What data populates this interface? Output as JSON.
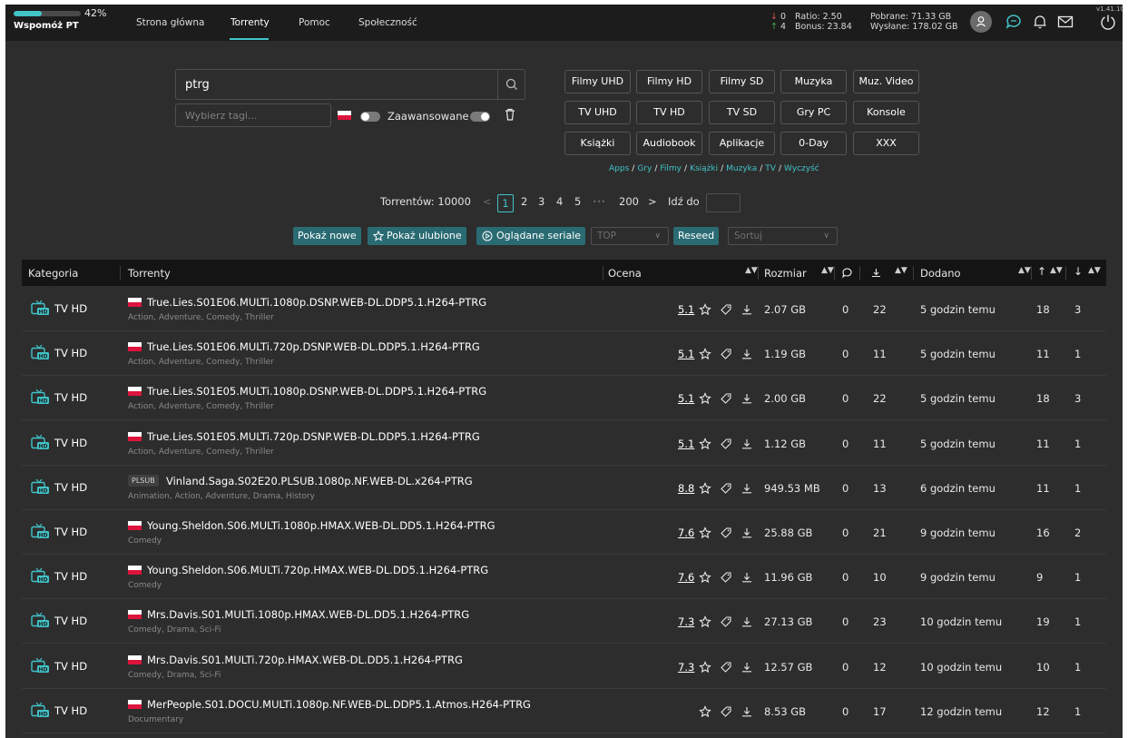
{
  "topbar": {
    "support_label": "Wspomóż PT",
    "support_pct_text": "42%",
    "support_progress": 0.42,
    "nav": [
      "Strona główna",
      "Torrenty",
      "Pomoc",
      "Społeczność"
    ],
    "active_nav_index": 1,
    "stats": {
      "down_arrow": "↓",
      "up_arrow": "↑",
      "down_count": "0",
      "up_count": "4",
      "ratio": "Ratio: 2.50",
      "bonus": "Bonus: 23.84",
      "downloaded": "Pobrane: 71.33 GB",
      "uploaded": "Wysłane: 178.02 GB"
    },
    "version": "v1.41.10",
    "accent_color": "#41c3c8"
  },
  "search": {
    "query": "ptrg",
    "tags_placeholder": "Wybierz tagi...",
    "advanced_label": "Zaawansowane"
  },
  "categories": [
    [
      "Filmy UHD",
      "Filmy HD",
      "Filmy SD",
      "Muzyka",
      "Muz. Video"
    ],
    [
      "TV UHD",
      "TV HD",
      "TV SD",
      "Gry PC",
      "Konsole"
    ],
    [
      "Książki",
      "Audiobook",
      "Aplikacje",
      "0-Day",
      "XXX"
    ]
  ],
  "crumbs": [
    "Apps",
    "Gry",
    "Filmy",
    "Książki",
    "Muzyka",
    "TV",
    "Wyczyść"
  ],
  "crumb_sep": "/",
  "pagination": {
    "total_label": "Torrentów: 10000",
    "prev": "<",
    "pages": [
      "1",
      "2",
      "3",
      "4",
      "5"
    ],
    "ellipsis": "•••",
    "last": "200",
    "next": ">",
    "goto_label": "Idź do"
  },
  "actions": {
    "show_new": "Pokaż nowe",
    "show_favorites": "Pokaż ulubione",
    "watched_series": "Oglądane seriale",
    "top_placeholder": "TOP",
    "reseed": "Reseed",
    "sort_placeholder": "Sortuj"
  },
  "table": {
    "headers": {
      "category": "Kategoria",
      "torrents": "Torrenty",
      "rating": "Ocena",
      "size": "Rozmiar",
      "added": "Dodano"
    },
    "rows": [
      {
        "cat": "TV HD",
        "flag": true,
        "badge": "",
        "name": "True.Lies.S01E06.MULTi.1080p.DSNP.WEB-DL.DDP5.1.H264-PTRG",
        "genres": "Action, Adventure, Comedy, Thriller",
        "rating": "5.1",
        "size": "2.07 GB",
        "comments": "0",
        "downloads": "22",
        "added": "5 godzin temu",
        "seeders": "18",
        "leechers": "3"
      },
      {
        "cat": "TV HD",
        "flag": true,
        "badge": "",
        "name": "True.Lies.S01E06.MULTi.720p.DSNP.WEB-DL.DDP5.1.H264-PTRG",
        "genres": "Action, Adventure, Comedy, Thriller",
        "rating": "5.1",
        "size": "1.19 GB",
        "comments": "0",
        "downloads": "11",
        "added": "5 godzin temu",
        "seeders": "11",
        "leechers": "1"
      },
      {
        "cat": "TV HD",
        "flag": true,
        "badge": "",
        "name": "True.Lies.S01E05.MULTi.1080p.DSNP.WEB-DL.DDP5.1.H264-PTRG",
        "genres": "Action, Adventure, Comedy, Thriller",
        "rating": "5.1",
        "size": "2.00 GB",
        "comments": "0",
        "downloads": "22",
        "added": "5 godzin temu",
        "seeders": "18",
        "leechers": "3"
      },
      {
        "cat": "TV HD",
        "flag": true,
        "badge": "",
        "name": "True.Lies.S01E05.MULTi.720p.DSNP.WEB-DL.DDP5.1.H264-PTRG",
        "genres": "Action, Adventure, Comedy, Thriller",
        "rating": "5.1",
        "size": "1.12 GB",
        "comments": "0",
        "downloads": "11",
        "added": "5 godzin temu",
        "seeders": "11",
        "leechers": "1"
      },
      {
        "cat": "TV HD",
        "flag": false,
        "badge": "PLSUB",
        "name": "Vinland.Saga.S02E20.PLSUB.1080p.NF.WEB-DL.x264-PTRG",
        "genres": "Animation, Action, Adventure, Drama, History",
        "rating": "8.8",
        "size": "949.53 MB",
        "comments": "0",
        "downloads": "13",
        "added": "6 godzin temu",
        "seeders": "11",
        "leechers": "1"
      },
      {
        "cat": "TV HD",
        "flag": true,
        "badge": "",
        "name": "Young.Sheldon.S06.MULTi.1080p.HMAX.WEB-DL.DD5.1.H264-PTRG",
        "genres": "Comedy",
        "rating": "7.6",
        "size": "25.88 GB",
        "comments": "0",
        "downloads": "21",
        "added": "9 godzin temu",
        "seeders": "16",
        "leechers": "2"
      },
      {
        "cat": "TV HD",
        "flag": true,
        "badge": "",
        "name": "Young.Sheldon.S06.MULTi.720p.HMAX.WEB-DL.DD5.1.H264-PTRG",
        "genres": "Comedy",
        "rating": "7.6",
        "size": "11.96 GB",
        "comments": "0",
        "downloads": "10",
        "added": "9 godzin temu",
        "seeders": "9",
        "leechers": "1"
      },
      {
        "cat": "TV HD",
        "flag": true,
        "badge": "",
        "name": "Mrs.Davis.S01.MULTi.1080p.HMAX.WEB-DL.DD5.1.H264-PTRG",
        "genres": "Comedy, Drama, Sci-Fi",
        "rating": "7.3",
        "size": "27.13 GB",
        "comments": "0",
        "downloads": "23",
        "added": "10 godzin temu",
        "seeders": "19",
        "leechers": "1"
      },
      {
        "cat": "TV HD",
        "flag": true,
        "badge": "",
        "name": "Mrs.Davis.S01.MULTi.720p.HMAX.WEB-DL.DD5.1.H264-PTRG",
        "genres": "Comedy, Drama, Sci-Fi",
        "rating": "7.3",
        "size": "12.57 GB",
        "comments": "0",
        "downloads": "12",
        "added": "10 godzin temu",
        "seeders": "10",
        "leechers": "1"
      },
      {
        "cat": "TV HD",
        "flag": true,
        "badge": "",
        "name": "MerPeople.S01.DOCU.MULTi.1080p.NF.WEB-DL.DDP5.1.Atmos.H264-PTRG",
        "genres": "Documentary",
        "rating": "",
        "size": "8.53 GB",
        "comments": "0",
        "downloads": "17",
        "added": "12 godzin temu",
        "seeders": "12",
        "leechers": "1"
      }
    ]
  }
}
